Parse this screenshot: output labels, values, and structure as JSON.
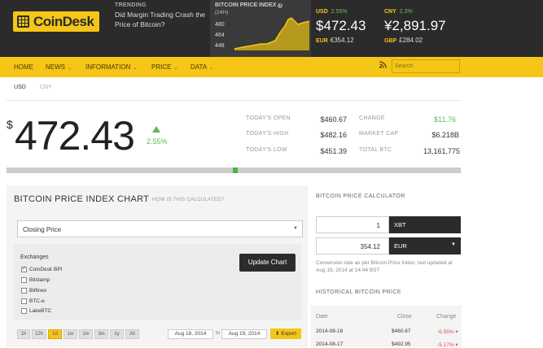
{
  "header": {
    "logo": "CoinDesk",
    "trending_label": "TRENDING",
    "trending_text": "Did Margin Trading Crash the Price of Bitcoin?",
    "bpi_label": "BITCOIN PRICE INDEX",
    "bpi_sub": "(24H)",
    "bpi_axis": [
      "480",
      "464",
      "448"
    ],
    "usd": {
      "code": "USD",
      "change": "2.55%",
      "price": "$472.43",
      "alt_code": "EUR",
      "alt_price": "€354.12"
    },
    "cny": {
      "code": "CNY",
      "change": "2.3%",
      "price": "¥2,891.97",
      "alt_code": "GBP",
      "alt_price": "£284.02"
    }
  },
  "nav": {
    "items": [
      "HOME",
      "NEWS",
      "INFORMATION",
      "PRICE",
      "DATA"
    ],
    "search_placeholder": "Search"
  },
  "currency_tabs": [
    "USD",
    "CNY"
  ],
  "price": {
    "symbol": "$",
    "value": "472.43",
    "change_pct": "2.55%"
  },
  "stats": {
    "open_label": "TODAY'S OPEN",
    "open": "$460.67",
    "high_label": "TODAY'S HIGH",
    "high": "$482.16",
    "low_label": "TODAY'S LOW",
    "low": "$451.39",
    "change_label": "CHANGE",
    "change": "$11.76",
    "mcap_label": "MARKET CAP",
    "mcap": "$6.218B",
    "total_label": "TOTAL BTC",
    "total": "13,161,775"
  },
  "chart_section": {
    "title": "BITCOIN PRICE INDEX CHART",
    "how": "HOW IS THIS CALCULATED?",
    "select_value": "Closing Price",
    "exchanges_label": "Exchanges",
    "exchanges": [
      {
        "name": "CoinDesk BPI",
        "checked": true
      },
      {
        "name": "Bitstamp",
        "checked": false
      },
      {
        "name": "Bitfinex",
        "checked": false
      },
      {
        "name": "BTC-e",
        "checked": false
      },
      {
        "name": "LakeBTC",
        "checked": false
      }
    ],
    "update_button": "Update Chart",
    "ranges": [
      "1h",
      "12h",
      "1d",
      "1w",
      "1m",
      "3m",
      "1y",
      "All"
    ],
    "active_range": "1d",
    "date_from": "Aug 18, 2014",
    "to_label": "to",
    "date_to": "Aug 19, 2014",
    "export_label": "Export"
  },
  "calculator": {
    "title": "BITCOIN PRICE CALCULATOR",
    "amount1": "1",
    "currency1": "XBT",
    "amount2": "354.12",
    "currency2": "EUR",
    "note": "Conversion rate as per Bitcoin Price Index, last updated at Aug 19, 2014 at 14:44 BST"
  },
  "history": {
    "title": "HISTORICAL BITCOIN PRICE",
    "headers": [
      "Date",
      "Close",
      "Change"
    ],
    "rows": [
      {
        "date": "2014-08-18",
        "close": "$460.67",
        "change": "-6.55%"
      },
      {
        "date": "2014-08-17",
        "close": "$492.95",
        "change": "-5.17%"
      }
    ]
  },
  "colors": {
    "accent": "#f5c518",
    "dark": "#2b2b2b",
    "up": "#5cb85c",
    "down": "#d9534f"
  }
}
